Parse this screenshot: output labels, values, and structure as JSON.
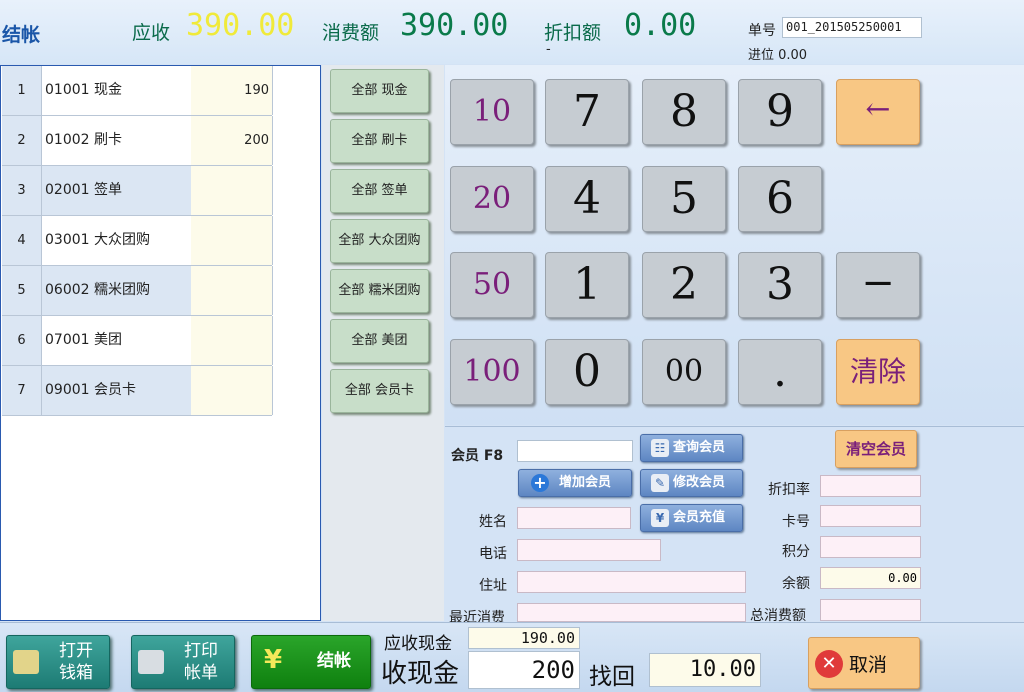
{
  "header": {
    "title": "结帐",
    "receivable_label": "应收",
    "receivable_value": "390.00",
    "consume_label": "消费额",
    "consume_value": "390.00",
    "discount_label": "折扣额",
    "discount_value": "0.00",
    "dash": "-",
    "bill_no_label": "单号",
    "bill_no_value": "001_201505250001",
    "carry_label": "进位 0.00"
  },
  "payment_list": [
    {
      "idx": "1",
      "name": "01001  现金",
      "amount": "190"
    },
    {
      "idx": "2",
      "name": "01002  刷卡",
      "amount": "200"
    },
    {
      "idx": "3",
      "name": "02001  签单",
      "amount": ""
    },
    {
      "idx": "4",
      "name": "03001  大众团购",
      "amount": ""
    },
    {
      "idx": "5",
      "name": "06002  糯米团购",
      "amount": ""
    },
    {
      "idx": "6",
      "name": "07001  美团",
      "amount": ""
    },
    {
      "idx": "7",
      "name": "09001  会员卡",
      "amount": ""
    }
  ],
  "pay_all_buttons": [
    "全部 现金",
    "全部 刷卡",
    "全部 签单",
    "全部 大众团购",
    "全部 糯米团购",
    "全部 美团",
    "全部 会员卡"
  ],
  "keypad": {
    "quick": [
      "10",
      "20",
      "50",
      "100"
    ],
    "digits": [
      "7",
      "8",
      "9",
      "4",
      "5",
      "6",
      "1",
      "2",
      "3",
      "0",
      "00",
      "."
    ],
    "backspace": "←",
    "minus": "−",
    "clear": "清除"
  },
  "member": {
    "member_label": "会员 F8",
    "query_btn": "查询会员",
    "add_btn": "增加会员",
    "edit_btn": "修改会员",
    "recharge_btn": "会员充值",
    "clear_btn": "清空会员",
    "name_label": "姓名",
    "phone_label": "电话",
    "address_label": "住址",
    "last_consume_label": "最近消费",
    "discount_rate_label": "折扣率",
    "card_no_label": "卡号",
    "points_label": "积分",
    "balance_label": "余额",
    "balance_value": "0.00",
    "total_consume_label": "总消费额"
  },
  "footer": {
    "open_drawer": "打开钱箱",
    "open_drawer_l1": "打开",
    "open_drawer_l2": "钱箱",
    "print_l1": "打印",
    "print_l2": "帐单",
    "checkout": "结帐",
    "cash_due_label": "应收现金",
    "cash_due_value": "190.00",
    "cash_received_label": "收现金",
    "cash_received_value": "200",
    "change_label": "找回",
    "change_value": "10.00",
    "cancel": "取消"
  },
  "colors": {
    "accent_blue": "#1a56a8",
    "header_green": "#0a6a4a",
    "yellow_value": "#f0ea3a",
    "orange_key": "#f8c784",
    "teal_button": "#1d7b74"
  }
}
